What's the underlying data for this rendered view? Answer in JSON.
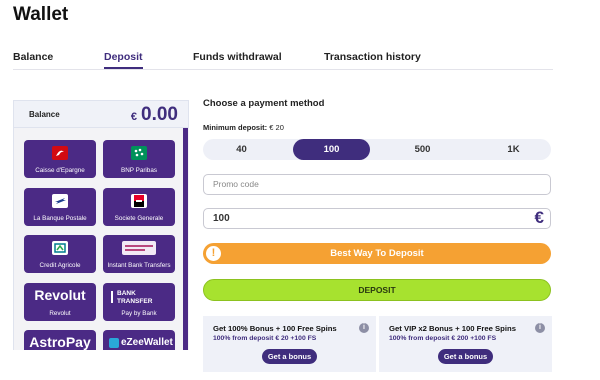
{
  "page": {
    "title": "Wallet"
  },
  "tabs": [
    {
      "label": "Balance"
    },
    {
      "label": "Deposit",
      "active": true
    },
    {
      "label": "Funds withdrawal"
    },
    {
      "label": "Transaction history"
    }
  ],
  "balance": {
    "label": "Balance",
    "currency": "€",
    "value": "0.00"
  },
  "methods": [
    {
      "name": "Caisse d'Epargne",
      "icon": "caisse-epargne-logo"
    },
    {
      "name": "BNP Paribas",
      "icon": "bnp-paribas-logo"
    },
    {
      "name": "La Banque Postale",
      "icon": "la-banque-postale-logo"
    },
    {
      "name": "Societe Generale",
      "icon": "societe-generale-logo"
    },
    {
      "name": "Credit Agricole",
      "icon": "credit-agricole-logo"
    },
    {
      "name": "Instant Bank Transfers",
      "icon": "instant-bank-transfer-logo"
    },
    {
      "name": "Revolut",
      "logo_text": "Revolut"
    },
    {
      "name": "Pay by Bank",
      "logo_text": "BANK TRANSFER"
    },
    {
      "name": "AstroPay",
      "logo_text": "AstroPay"
    },
    {
      "name": "eZeeWallet",
      "logo_text": "eZeeWallet"
    }
  ],
  "payment": {
    "heading": "Choose a payment method",
    "min_deposit_label": "Minimum deposit:",
    "min_deposit_value": "€ 20",
    "amounts": [
      "40",
      "100",
      "500",
      "1K"
    ],
    "selected_amount": "100",
    "promo_placeholder": "Promo code",
    "amount_value": "100",
    "currency_symbol": "€",
    "best_way_label": "Best Way To Deposit",
    "deposit_label": "DEPOSIT"
  },
  "bonuses": [
    {
      "title": "Get 100% Bonus + 100 Free Spins",
      "subtitle": "100% from deposit € 20 +100 FS",
      "button": "Get a bonus"
    },
    {
      "title": "Get VIP x2 Bonus + 100 Free Spins",
      "subtitle": "100% from deposit € 200 +100 FS",
      "button": "Get a bonus"
    }
  ],
  "colors": {
    "brand_purple": "#3f2d7d",
    "method_purple": "#4b2a85",
    "orange": "#f5a133",
    "green": "#a7e22f",
    "caisse_epargne": "#d20a11",
    "bnp": "#00915a",
    "banque_postale": "#1d3f8f",
    "societe_generale": "#e60028",
    "credit_agricole": "#007d8f",
    "instant_transfer": "#f2eaf5"
  }
}
